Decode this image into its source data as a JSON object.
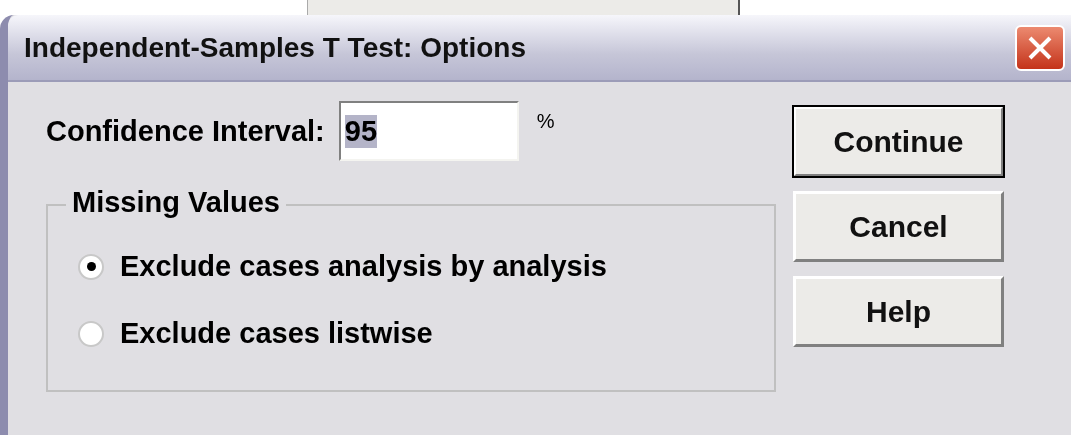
{
  "window": {
    "title": "Independent-Samples T Test: Options"
  },
  "confidence": {
    "label": "Confidence Interval:",
    "value": "95",
    "value_highlighted": true,
    "unit": "%"
  },
  "missing_values": {
    "title": "Missing Values",
    "options": [
      {
        "label": "Exclude cases analysis by analysis",
        "selected": true
      },
      {
        "label": "Exclude cases listwise",
        "selected": false
      }
    ]
  },
  "buttons": [
    {
      "label": "Continue",
      "default": true
    },
    {
      "label": "Cancel",
      "default": false
    },
    {
      "label": "Help",
      "default": false
    }
  ]
}
